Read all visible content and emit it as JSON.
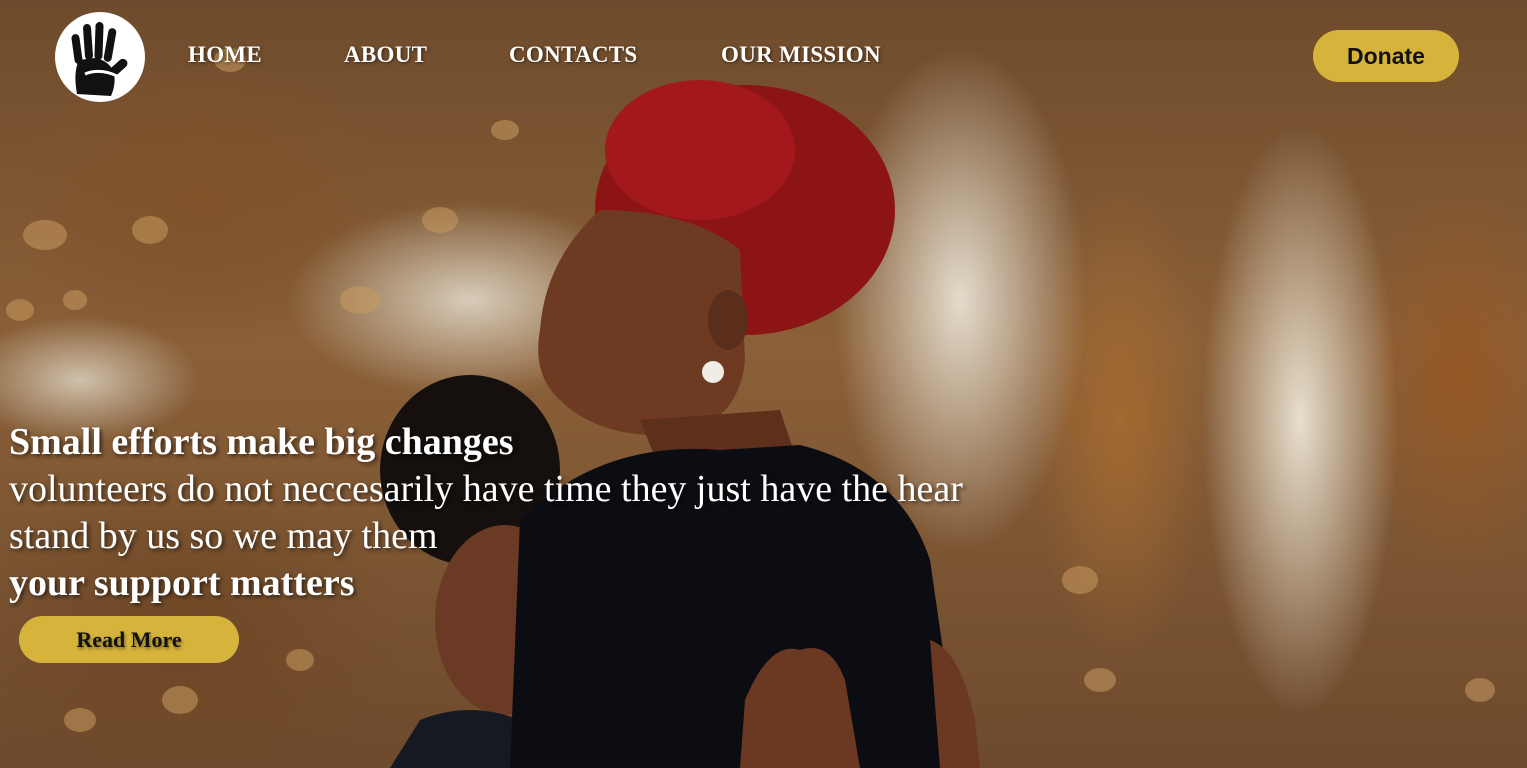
{
  "nav": {
    "items": [
      {
        "label": "HOME"
      },
      {
        "label": "ABOUT"
      },
      {
        "label": "CONTACTS"
      },
      {
        "label": "OUR MISSION"
      }
    ],
    "donate_label": "Donate"
  },
  "hero": {
    "headline": "Small efforts make big changes",
    "line1": "volunteers do not neccesarily have time they just have the hear",
    "line2": "stand by us so we may them",
    "emphasis": "your support matters",
    "read_more_label": "Read More"
  },
  "icons": {
    "logo": "raised-hand-icon"
  },
  "colors": {
    "accent": "#d6b43c",
    "nav_text": "#ffffff",
    "button_text": "#111111"
  }
}
